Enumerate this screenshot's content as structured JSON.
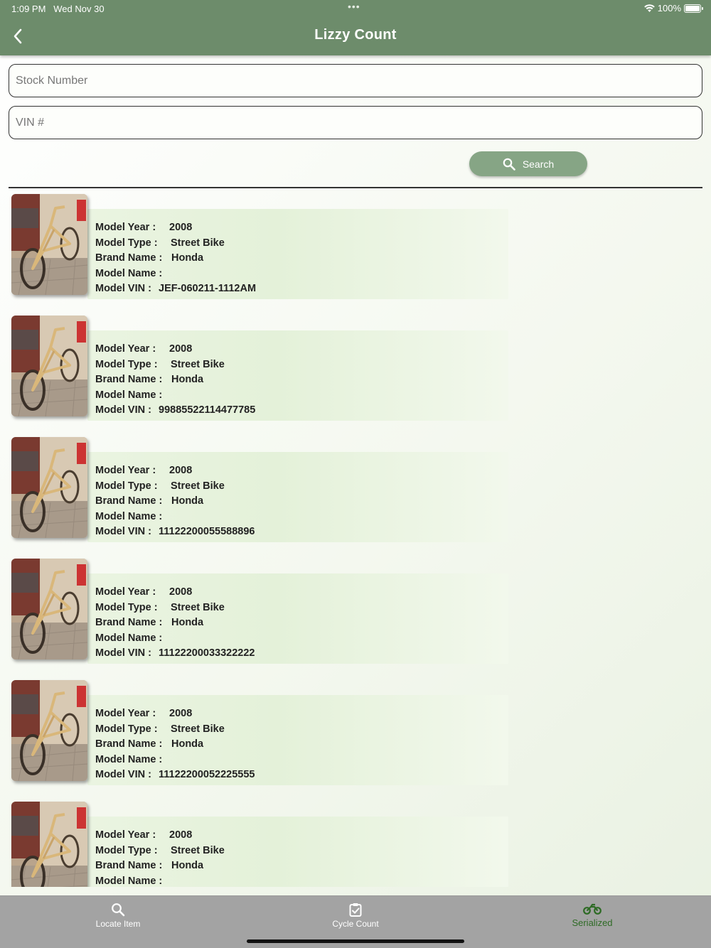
{
  "status_bar": {
    "time": "1:09 PM",
    "date": "Wed Nov 30",
    "dots": "•••",
    "battery": "100%"
  },
  "header": {
    "title": "Lizzy Count",
    "back_icon": "chevron-left-icon"
  },
  "search": {
    "stock_placeholder": "Stock Number",
    "vin_placeholder": "VIN #",
    "button_label": "Search"
  },
  "labels": {
    "year": "Model Year :",
    "type": "Model Type :",
    "brand": "Brand Name :",
    "name": "Model Name :",
    "vin": "Model VIN :"
  },
  "items": [
    {
      "year": "2008",
      "type": "Street Bike",
      "brand": "Honda",
      "name": "",
      "vin": "JEF-060211-1112AM"
    },
    {
      "year": "2008",
      "type": "Street Bike",
      "brand": "Honda",
      "name": "",
      "vin": "99885522114477785"
    },
    {
      "year": "2008",
      "type": "Street Bike",
      "brand": "Honda",
      "name": "",
      "vin": "11122200055588896"
    },
    {
      "year": "2008",
      "type": "Street Bike",
      "brand": "Honda",
      "name": "",
      "vin": "11122200033322222"
    },
    {
      "year": "2008",
      "type": "Street Bike",
      "brand": "Honda",
      "name": "",
      "vin": "11122200052225555"
    },
    {
      "year": "2008",
      "type": "Street Bike",
      "brand": "Honda",
      "name": "",
      "vin": ""
    }
  ],
  "tabs": [
    {
      "label": "Locate Item",
      "icon": "search-icon",
      "active": false
    },
    {
      "label": "Cycle Count",
      "icon": "clipboard-check-icon",
      "active": false
    },
    {
      "label": "Serialized",
      "icon": "motorcycle-icon",
      "active": true
    }
  ],
  "colors": {
    "header": "#6d8c6b",
    "search_button": "#86a585",
    "active_tab": "#2e6b25",
    "tab_bar": "#a3a3a3"
  }
}
